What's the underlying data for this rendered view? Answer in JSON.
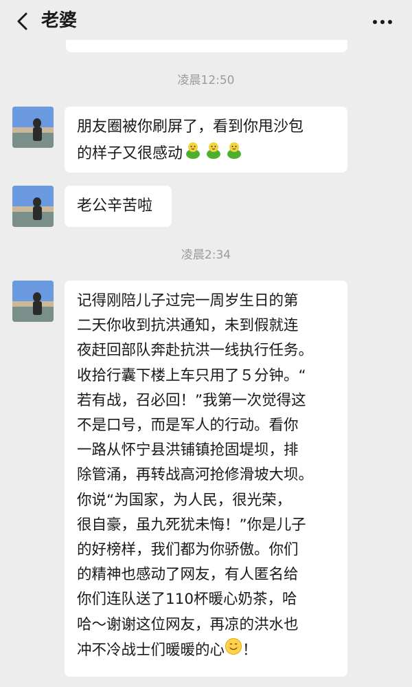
{
  "header": {
    "title": "老婆",
    "back_icon": "chevron-left-icon",
    "more_icon": "more-dots-icon"
  },
  "messages": [
    {
      "timestamp": "凌晨12:50",
      "bubbles": [
        {
          "lines": [
            "朋友圈被你刷屏了，看到你甩沙包",
            "的样子又很感动"
          ],
          "emoji_after": [
            "chick-emoji",
            "chick-emoji",
            "chick-emoji"
          ]
        },
        {
          "lines": [
            "老公辛苦啦"
          ]
        }
      ]
    },
    {
      "timestamp": "凌晨2:34",
      "bubbles": [
        {
          "lines": [
            "记得刚陪儿子过完一周岁生日的第",
            "二天你收到抗洪通知，未到假就连",
            "夜赶回部队奔赴抗洪一线执行任务。",
            "收拾行囊下楼上车只用了５分钟。“",
            "若有战，召必回！”我第一次觉得这",
            "不是口号，而是军人的行动。看你",
            "一路从怀宁县洪铺镇抢固堤坝，排",
            "除管涌，再转战高河抢修滑坡大坝。",
            "你说“为国家，为人民，很光荣，",
            "很自豪，虽九死犹未悔！”你是儿子",
            "的好榜样，我们都为你骄傲。你们",
            "的精神也感动了网友，有人匿名给",
            "你们连队送了110杯暖心奶茶，哈",
            "哈～谢谢这位网友，再凉的洪水也",
            "冲不冷战士们暖暖的心"
          ],
          "last_line_suffix": "！",
          "emoji_inline": "smiling-face-emoji"
        }
      ]
    }
  ],
  "colors": {
    "background": "#ededed",
    "bubble": "#ffffff",
    "timestamp": "#9b9b9b",
    "text": "#191919"
  }
}
